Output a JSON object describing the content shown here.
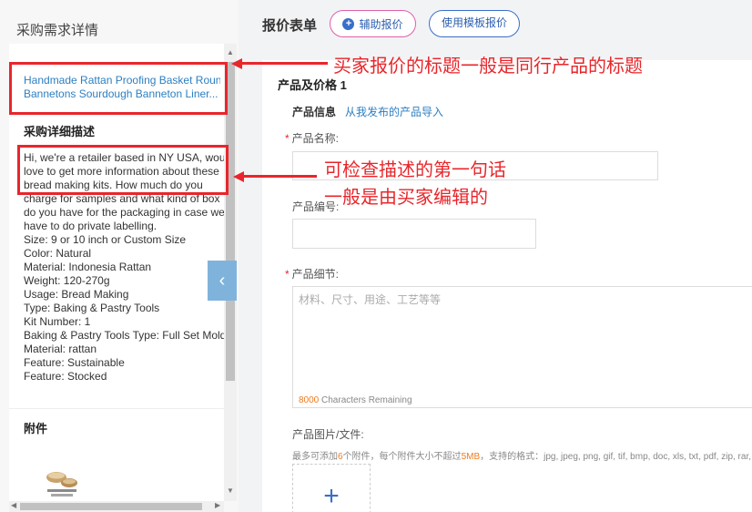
{
  "left": {
    "panel_title": "采购需求详情",
    "request_title_lines": [
      "Handmade Rattan Proofing Basket Round",
      "Bannetons Sourdough Banneton Liner..."
    ],
    "description_heading": "采购详细描述",
    "description_lines": [
      "Hi, we're a retailer based in NY USA, would",
      "love to get more information about these",
      "bread making kits. How much do you",
      "charge for samples and what kind of box",
      "do you have for the packaging in case we",
      "have to do private labelling.",
      "Size: 9 or 10 inch or Custom Size",
      "Color: Natural",
      "Material: Indonesia Rattan",
      "Weight: 120-270g",
      "Usage: Bread Making",
      "Type: Baking & Pastry Tools",
      "Kit Number: 1",
      "Baking & Pastry Tools Type: Full Set Mold",
      "Material: rattan",
      "Feature: Sustainable",
      "Feature: Stocked"
    ],
    "attachments_heading": "附件",
    "collapse_icon": "chevron-left-icon"
  },
  "form": {
    "title": "报价表单",
    "assist_button": "辅助报价",
    "template_button": "使用模板报价",
    "section_title": "产品及价格 1",
    "product_info_label": "产品信息",
    "import_link": "从我发布的产品导入",
    "name_label": "产品名称:",
    "code_label": "产品编号:",
    "detail_label": "产品细节:",
    "detail_placeholder": "材料、尺寸、用途、工艺等等",
    "chars_remaining_num": "8000",
    "chars_remaining_text": " Characters Remaining",
    "files_label": "产品图片/文件:",
    "upload_hint_pre": "最多可添加",
    "upload_hint_num1": "6",
    "upload_hint_mid": "个附件，每个附件大小不超过",
    "upload_hint_num2": "5MB",
    "upload_hint_post": "，支持的格式：jpg, jpeg, png, gif, tif, bmp, doc, xls, txt, pdf, zip, rar, do",
    "upload_plus": "+"
  },
  "annotations": {
    "title_note": "买家报价的标题一般是同行产品的标题",
    "desc_note_line1": "可检查描述的第一句话",
    "desc_note_line2": "一般是由买家编辑的"
  },
  "colors": {
    "annotation_red": "#e8262b",
    "link_blue": "#2d7fc1",
    "accent_orange": "#f07b1d"
  }
}
